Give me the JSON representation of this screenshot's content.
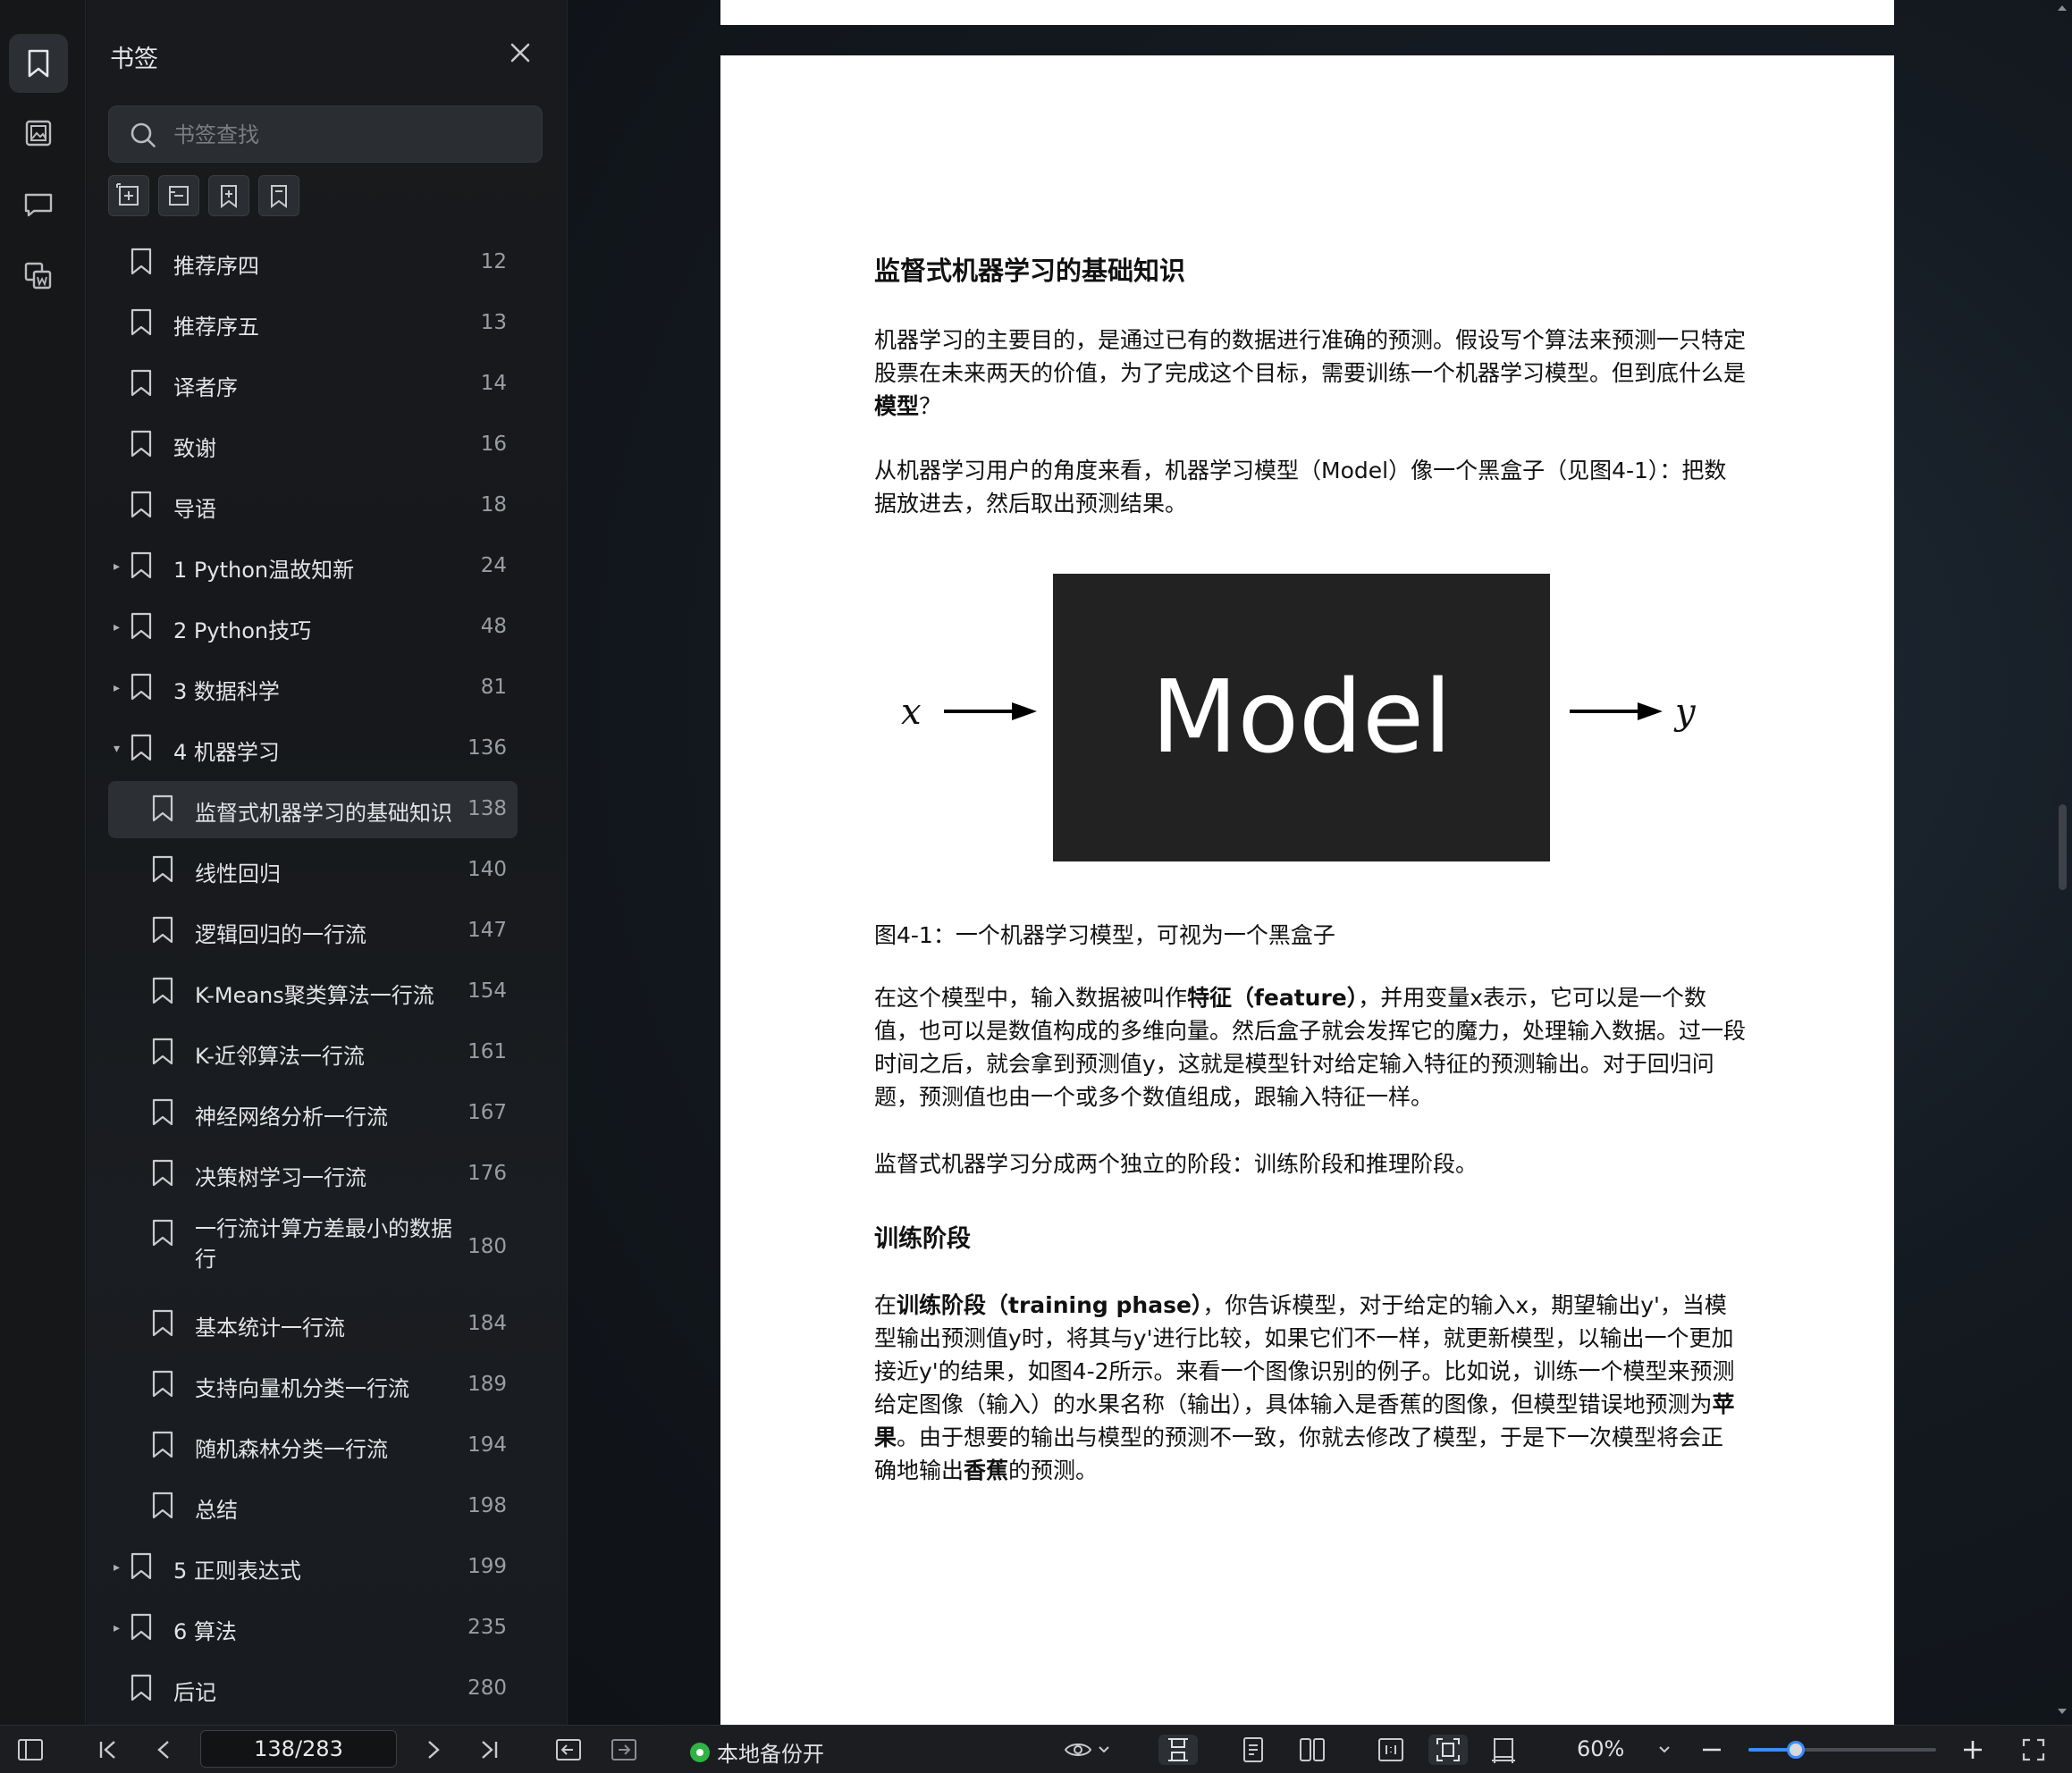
{
  "sidebar": {
    "title": "书签",
    "search_placeholder": "书签查找",
    "items": [
      {
        "label": "推荐序四",
        "page": "12",
        "level": 0,
        "caret": ""
      },
      {
        "label": "推荐序五",
        "page": "13",
        "level": 0,
        "caret": ""
      },
      {
        "label": "译者序",
        "page": "14",
        "level": 0,
        "caret": ""
      },
      {
        "label": "致谢",
        "page": "16",
        "level": 0,
        "caret": ""
      },
      {
        "label": "导语",
        "page": "18",
        "level": 0,
        "caret": ""
      },
      {
        "label": "1 Python温故知新",
        "page": "24",
        "level": 0,
        "caret": "▸"
      },
      {
        "label": "2 Python技巧",
        "page": "48",
        "level": 0,
        "caret": "▸"
      },
      {
        "label": "3 数据科学",
        "page": "81",
        "level": 0,
        "caret": "▸"
      },
      {
        "label": "4 机器学习",
        "page": "136",
        "level": 0,
        "caret": "▾"
      },
      {
        "label": "监督式机器学习的基础知识",
        "page": "138",
        "level": 1,
        "caret": "",
        "selected": true
      },
      {
        "label": "线性回归",
        "page": "140",
        "level": 1,
        "caret": ""
      },
      {
        "label": "逻辑回归的一行流",
        "page": "147",
        "level": 1,
        "caret": ""
      },
      {
        "label": "K-Means聚类算法一行流",
        "page": "154",
        "level": 1,
        "caret": ""
      },
      {
        "label": "K-近邻算法一行流",
        "page": "161",
        "level": 1,
        "caret": ""
      },
      {
        "label": "神经网络分析一行流",
        "page": "167",
        "level": 1,
        "caret": ""
      },
      {
        "label": "决策树学习一行流",
        "page": "176",
        "level": 1,
        "caret": ""
      },
      {
        "label": "一行流计算方差最小的数据行",
        "page": "180",
        "level": 1,
        "caret": "",
        "tall": true
      },
      {
        "label": "基本统计一行流",
        "page": "184",
        "level": 1,
        "caret": ""
      },
      {
        "label": "支持向量机分类一行流",
        "page": "189",
        "level": 1,
        "caret": ""
      },
      {
        "label": "随机森林分类一行流",
        "page": "194",
        "level": 1,
        "caret": ""
      },
      {
        "label": "总结",
        "page": "198",
        "level": 1,
        "caret": ""
      },
      {
        "label": "5 正则表达式",
        "page": "199",
        "level": 0,
        "caret": "▸"
      },
      {
        "label": "6 算法",
        "page": "235",
        "level": 0,
        "caret": "▸"
      },
      {
        "label": "后记",
        "page": "280",
        "level": 0,
        "caret": ""
      }
    ]
  },
  "page": {
    "heading": "监督式机器学习的基础知识",
    "p1a": "机器学习的主要目的，是通过已有的数据进行准确的预测。假设写个算法来预测一只特定股票在未来两天的价值，为了完成这个目标，需要训练一个机器学习模型。但到底什么是",
    "p1b": "模型",
    "p1c": "？",
    "p2": "从机器学习用户的角度来看，机器学习模型（Model）像一个黑盒子（见图4-1）：把数据放进去，然后取出预测结果。",
    "fig_box": "Model",
    "fig_x": "x",
    "fig_y": "y",
    "caption": "图4-1：一个机器学习模型，可视为一个黑盒子",
    "p3a": "在这个模型中，输入数据被叫作",
    "p3b": "特征（feature）",
    "p3c": "，并用变量x表示，它可以是一个数值，也可以是数值构成的多维向量。然后盒子就会发挥它的魔力，处理输入数据。过一段时间之后，就会拿到预测值y，这就是模型针对给定输入特征的预测输出。对于回归问题，预测值也由一个或多个数值组成，跟输入特征一样。",
    "p4": "监督式机器学习分成两个独立的阶段：训练阶段和推理阶段。",
    "subheading": "训练阶段",
    "p5a": "在",
    "p5b": "训练阶段（training phase）",
    "p5c": "，你告诉模型，对于给定的输入x，期望输出y'，当模型输出预测值y时，将其与y'进行比较，如果它们不一样，就更新模型，以输出一个更加接近y'的结果，如图4-2所示。来看一个图像识别的例子。比如说，训练一个模型来预测给定图像（输入）的水果名称（输出），具体输入是香蕉的图像，但模型错误地预测为",
    "p5d": "苹果",
    "p5e": "。由于想要的输出与模型的预测不一致，你就去修改了模型，于是下一次模型将会正确地输出",
    "p5f": "香蕉",
    "p5g": "的预测。"
  },
  "toolbar": {
    "page_indicator": "138/283",
    "backup_label": "本地备份开",
    "zoom": "60%",
    "zoom_fraction": 0.25
  },
  "colors": {
    "accent": "#3d8bfd",
    "backup_green": "#2fb344",
    "selection": "#2c2f34"
  },
  "icons": [
    "bookmark-icon",
    "image-icon",
    "comment-icon",
    "extract-icon",
    "search-icon",
    "close-icon"
  ]
}
